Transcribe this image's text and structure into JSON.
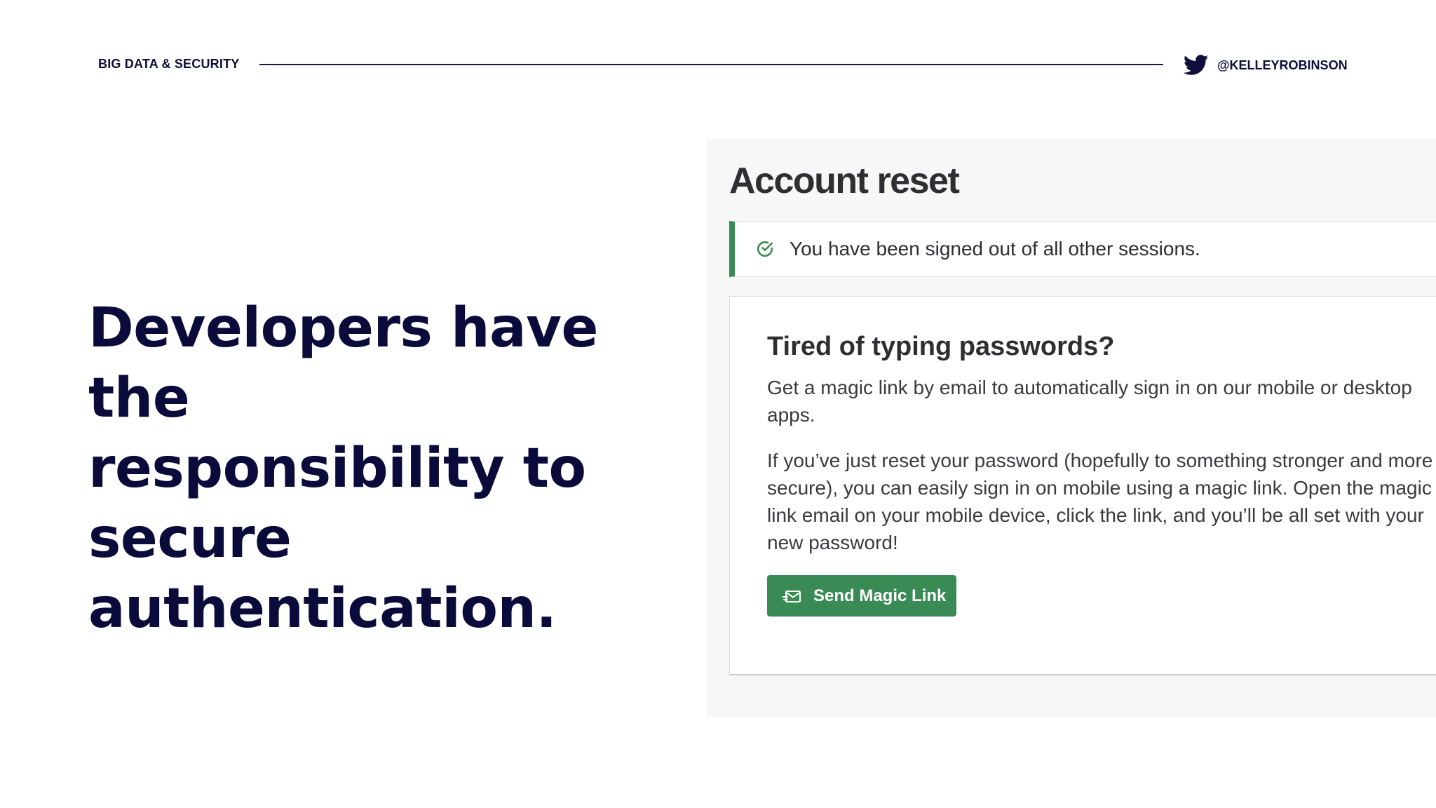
{
  "slide": {
    "label": "BIG DATA & SECURITY",
    "handle": "@KELLEYROBINSON",
    "handle_icon": "twitter-bird-icon",
    "headline_lines": [
      "Developers have the",
      "responsibility to",
      "secure authentication."
    ]
  },
  "account_reset": {
    "title": "Account reset",
    "alert": {
      "icon": "check-circle-icon",
      "text": "You have been signed out of all other sessions."
    },
    "card": {
      "heading": "Tired of typing passwords?",
      "paragraph_1": "Get a magic link by email to automatically sign in on our mobile or desktop apps.",
      "paragraph_2": "If you’ve just reset your password (hopefully to something stronger and more secure), you can easily sign in on mobile using a magic link. Open the magic link email on your mobile device, click the link, and you’ll be all set with your new password!",
      "button": {
        "icon": "mail-send-icon",
        "label": "Send Magic Link"
      }
    }
  },
  "colors": {
    "navy": "#0b0b3b",
    "success_green": "#3b8a52",
    "button_green": "#3a8a55",
    "text_dark": "#2e2e33",
    "panel_bg": "#f7f7f8"
  }
}
